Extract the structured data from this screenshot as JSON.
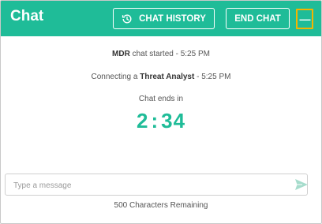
{
  "header": {
    "title": "Chat",
    "chat_history_label": "CHAT HISTORY",
    "end_chat_label": "END CHAT",
    "more_label": "—",
    "accent_color": "#1fbc98",
    "more_focus_color": "#f5b400"
  },
  "status": {
    "line1_bold": "MDR",
    "line1_rest": " chat started - 5:25 PM",
    "line2_prefix": "Connecting a ",
    "line2_bold": "Threat Analyst",
    "line2_suffix": " - 5:25 PM",
    "ends_label": "Chat ends in"
  },
  "timer": {
    "minutes": "2",
    "separator": ":",
    "seconds": "34"
  },
  "composer": {
    "placeholder": "Type a message",
    "value": "",
    "send_icon": "send-icon",
    "remaining": "500 Characters Remaining"
  },
  "icons": {
    "history": "history-icon",
    "more": "more-icon"
  }
}
